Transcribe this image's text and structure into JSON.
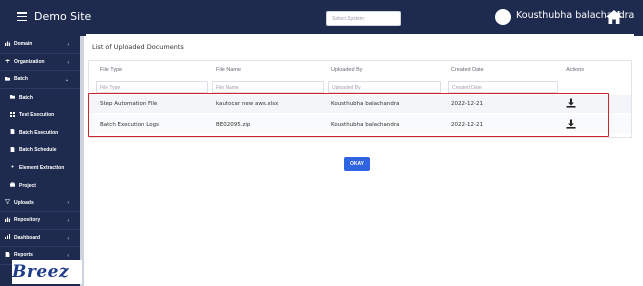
{
  "header": {
    "site_title": "Demo Site",
    "system_select_placeholder": "Select System",
    "user_name": "Kousthubha balachandra"
  },
  "sidebar": {
    "items": [
      {
        "label": "Domain",
        "level": 0,
        "icon": "bar-chart-icon",
        "chevron": "›"
      },
      {
        "label": "Organization",
        "level": 0,
        "icon": "org-icon",
        "chevron": "›"
      },
      {
        "label": "Batch",
        "level": 0,
        "icon": "folder-icon",
        "chevron": "⌄"
      },
      {
        "label": "Batch",
        "level": 1,
        "icon": "folder-icon",
        "chevron": ""
      },
      {
        "label": "Test Execution",
        "level": 1,
        "icon": "grid-icon",
        "chevron": ""
      },
      {
        "label": "Batch Execution",
        "level": 1,
        "icon": "doc-icon",
        "chevron": ""
      },
      {
        "label": "Batch Schedule",
        "level": 1,
        "icon": "doc-icon",
        "chevron": ""
      },
      {
        "label": "Element Extraction",
        "level": 1,
        "icon": "dot-icon",
        "chevron": ""
      },
      {
        "label": "Project",
        "level": 1,
        "icon": "briefcase-icon",
        "chevron": ""
      },
      {
        "label": "Uploads",
        "level": 0,
        "icon": "filter-icon",
        "chevron": "›"
      },
      {
        "label": "Repository",
        "level": 0,
        "icon": "bar-chart-icon",
        "chevron": "›"
      },
      {
        "label": "Dashboard",
        "level": 0,
        "icon": "chart-icon",
        "chevron": "›"
      },
      {
        "label": "Reports",
        "level": 0,
        "icon": "doc-icon",
        "chevron": "‹"
      }
    ],
    "brand": "Breez"
  },
  "main": {
    "title": "List of Uploaded Documents",
    "columns": [
      "File Type",
      "File Name",
      "Uploaded By",
      "Created Date",
      "Actions"
    ],
    "filter_placeholders": [
      "File Type",
      "File Name",
      "Uploaded By",
      "Created Date"
    ],
    "rows": [
      {
        "file_type": "Step Automation File",
        "file_name": "kautocar new aws.xlsx",
        "uploaded_by": "Kousthubha balachandra",
        "created_date": "2022-12-21",
        "action_icon": "download-icon"
      },
      {
        "file_type": "Batch Execution Logs",
        "file_name": "BE02095.zip",
        "uploaded_by": "Kousthubha balachandra",
        "created_date": "2022-12-21",
        "action_icon": "download-icon"
      }
    ],
    "ok_label": "OKAY"
  },
  "colors": {
    "navy": "#1f2a4f",
    "accent_blue": "#2f63e0",
    "highlight_red": "#d0232b"
  }
}
